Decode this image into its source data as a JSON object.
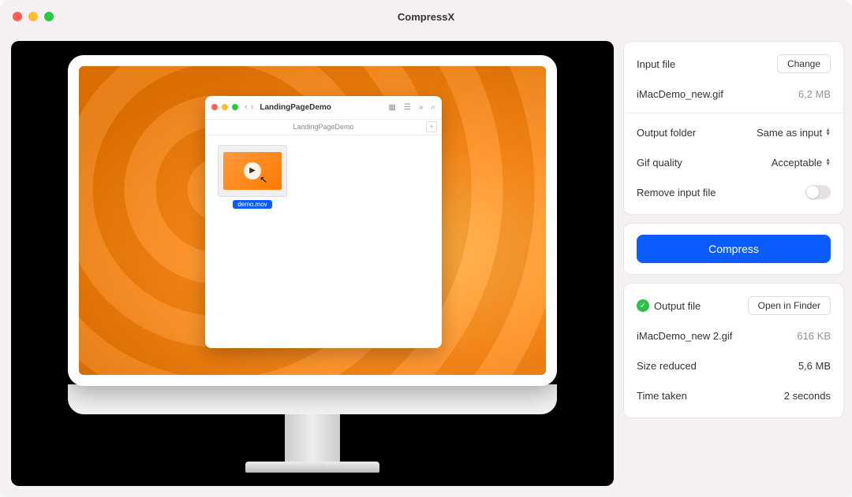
{
  "app": {
    "title": "CompressX"
  },
  "preview": {
    "finder": {
      "title": "LandingPageDemo",
      "tab": "LandingPageDemo",
      "file_name": "demo.mov"
    }
  },
  "input": {
    "label": "Input file",
    "change_button": "Change",
    "filename": "iMacDemo_new.gif",
    "filesize": "6,2 MB"
  },
  "settings": {
    "output_folder_label": "Output folder",
    "output_folder_value": "Same as input",
    "gif_quality_label": "Gif quality",
    "gif_quality_value": "Acceptable",
    "remove_input_label": "Remove input file"
  },
  "action": {
    "compress": "Compress"
  },
  "output": {
    "label": "Output file",
    "open_button": "Open in Finder",
    "filename": "iMacDemo_new 2.gif",
    "filesize": "616 KB",
    "size_reduced_label": "Size reduced",
    "size_reduced_value": "5,6 MB",
    "time_taken_label": "Time taken",
    "time_taken_value": "2 seconds"
  }
}
